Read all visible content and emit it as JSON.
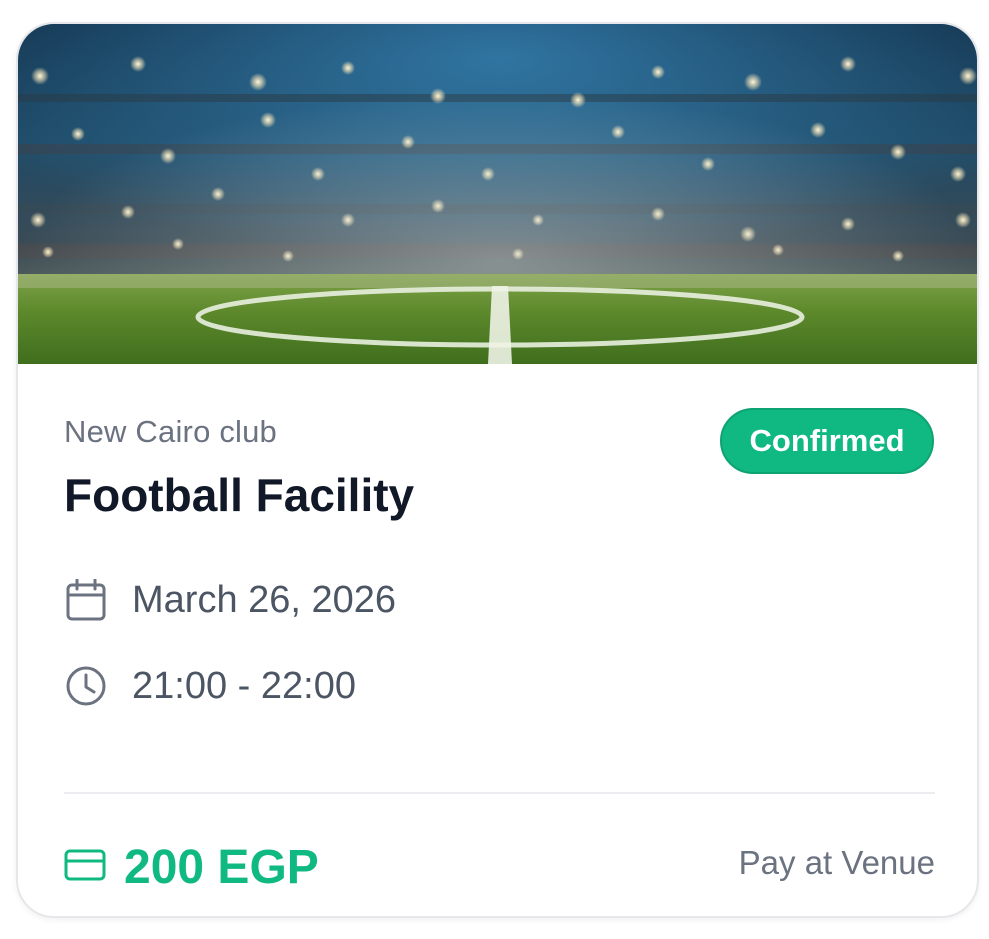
{
  "booking": {
    "venue_name": "New Cairo club",
    "facility_name": "Football Facility",
    "status": "Confirmed",
    "date": "March 26, 2026",
    "time": "21:00 - 22:00",
    "price": "200 EGP",
    "payment_method": "Pay at Venue"
  },
  "icons": {
    "date": "calendar-icon",
    "time": "clock-icon",
    "price": "credit-card-icon"
  },
  "colors": {
    "accent": "#10b981",
    "title": "#111827",
    "muted": "#6b7280"
  }
}
